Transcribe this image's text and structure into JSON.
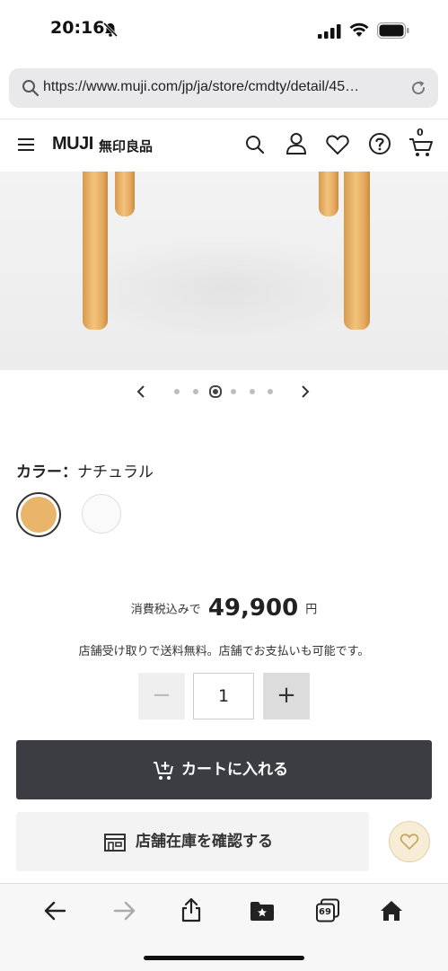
{
  "status_bar": {
    "time": "20:16"
  },
  "browser": {
    "url": "https://www.muji.com/jp/ja/store/cmdty/detail/45…"
  },
  "header": {
    "logo": "MUJI",
    "logo_jp": "無印良品",
    "icons": [
      "menu-icon",
      "search-icon",
      "account-icon",
      "heart-icon",
      "help-icon",
      "cart-icon"
    ],
    "cart_count": "0"
  },
  "carousel": {
    "total": 6,
    "active_index": 2
  },
  "product": {
    "color_label": "カラー：",
    "color_value": "ナチュラル",
    "swatches": [
      {
        "name": "ナチュラル",
        "color": "#e8b56a",
        "selected": true
      },
      {
        "name": "white",
        "color": "#fafafa",
        "selected": false
      }
    ],
    "price_prefix": "消費税込みで",
    "price": "49,900",
    "price_unit": "円",
    "store_note": "店舗受け取りで送料無料。店舗でお支払いも可能です。",
    "quantity": "1",
    "qty_minus": "−",
    "qty_plus": "+"
  },
  "actions": {
    "cart_label": "カートに入れる",
    "store_label": "店舗在庫を確認する"
  },
  "toolbar": {
    "icons": [
      "back-icon",
      "forward-icon",
      "share-icon",
      "bookmarks-icon",
      "tabs-icon",
      "home-icon"
    ],
    "tab_count": "69"
  },
  "colors": {
    "cart_button": "#3b3d43",
    "accent_wood": "#e8b56a",
    "fav_bg": "#f7ecd5"
  }
}
